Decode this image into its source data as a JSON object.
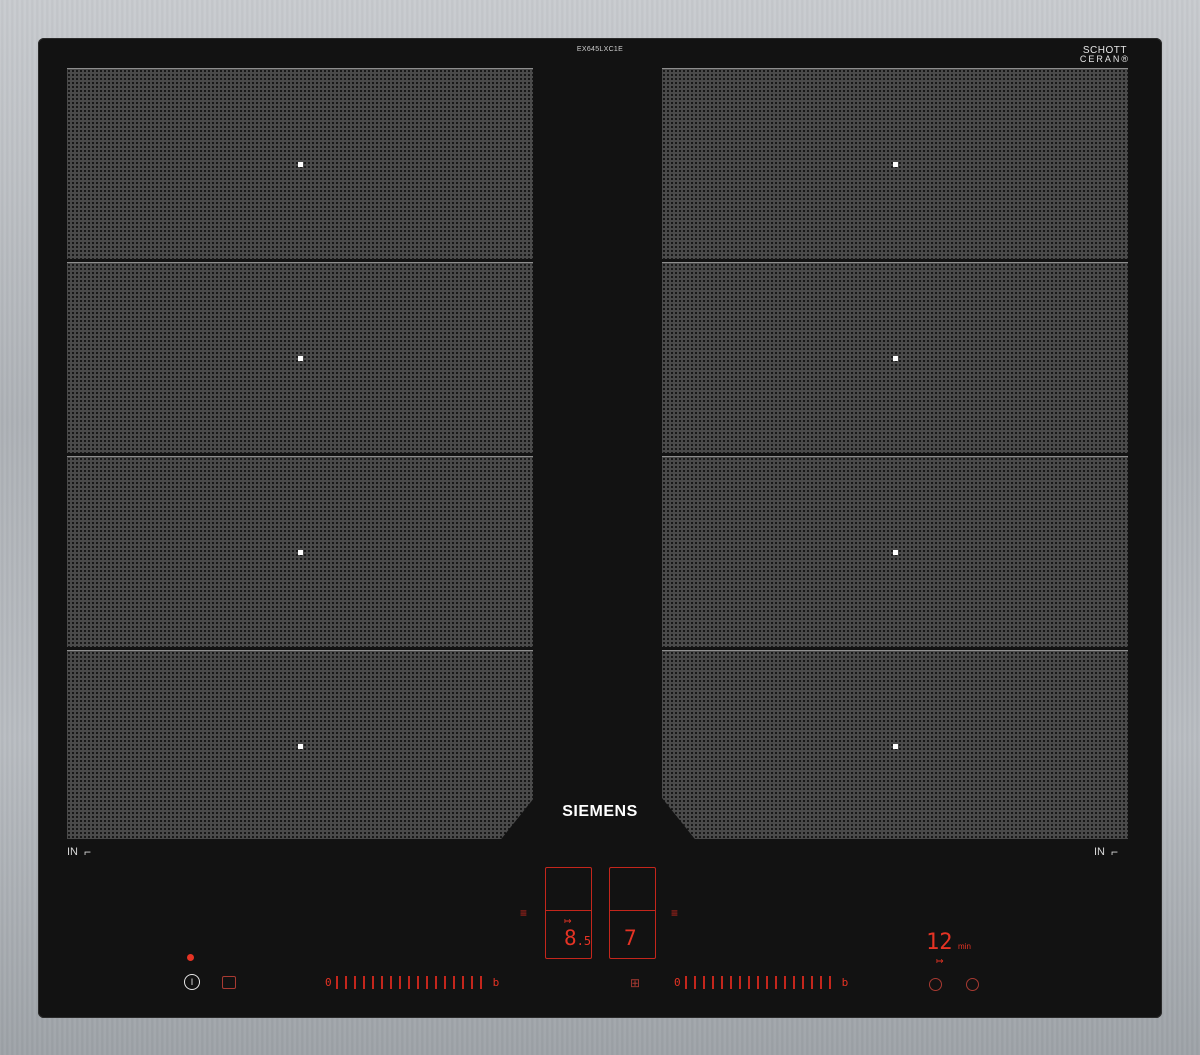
{
  "product": {
    "model_number": "EX645LXC1E",
    "glass_brand_line1": "SCHOTT",
    "glass_brand_line2": "CERAN®",
    "brand": "SIEMENS",
    "frame_color": "#b4b8bc",
    "glass_color": "#121212"
  },
  "zones": {
    "left": [
      {
        "marker": "on"
      },
      {
        "marker": "on"
      },
      {
        "marker": "on"
      },
      {
        "marker": "on"
      }
    ],
    "right": [
      {
        "marker": "on"
      },
      {
        "marker": "on"
      },
      {
        "marker": "on"
      },
      {
        "marker": "on"
      }
    ]
  },
  "labels": {
    "induction_left": "IN",
    "induction_right": "IN"
  },
  "controls": {
    "display1_value_main": "8",
    "display1_value_small": ".5",
    "display2_value": "7",
    "timer_value": "12",
    "timer_unit": "min",
    "slider_min": "0",
    "slider_max": "b",
    "slider_ticks": 17,
    "accent_color": "#e53324",
    "icons": [
      "power-icon",
      "child-lock-icon",
      "wipe-protection-icon",
      "clock-icon",
      "stopwatch-icon",
      "flexzone-bridge-icon",
      "timer-arrow-icon"
    ]
  }
}
